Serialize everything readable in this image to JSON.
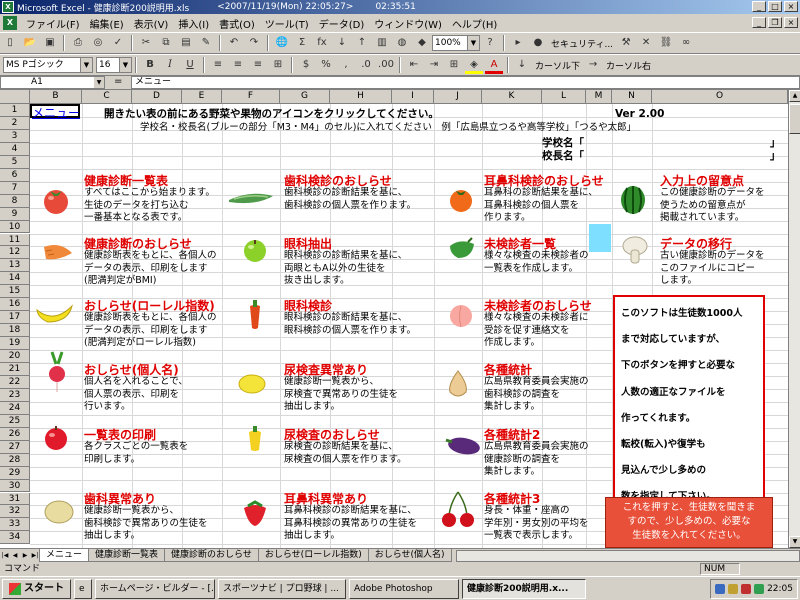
{
  "window": {
    "title": "Microsoft Excel - 健康診断200説明用.xls",
    "title_date": "<2007/11/19(Mon) 22:05:27>",
    "title_time": "02:35:51"
  },
  "menu": [
    "ファイル(F)",
    "編集(E)",
    "表示(V)",
    "挿入(I)",
    "書式(O)",
    "ツール(T)",
    "データ(D)",
    "ウィンドウ(W)",
    "ヘルプ(H)"
  ],
  "toolbar": {
    "zoom": "100%",
    "security_label": "セキュリティ...",
    "font_name": "MS Pゴシック",
    "font_size": "16",
    "cursor_down": "カーソル下",
    "cursor_right": "カーソル右"
  },
  "formula_bar": {
    "name_box": "A1",
    "content": "メニュー"
  },
  "columns": [
    "B",
    "C",
    "D",
    "E",
    "F",
    "G",
    "H",
    "I",
    "J",
    "K",
    "L",
    "M",
    "N",
    "O"
  ],
  "rows": [
    "1",
    "2",
    "3",
    "4",
    "5",
    "6",
    "7",
    "8",
    "9",
    "10",
    "11",
    "12",
    "13",
    "14",
    "15",
    "16",
    "17",
    "18",
    "19",
    "20",
    "21",
    "22",
    "23",
    "24",
    "25",
    "26",
    "27",
    "28",
    "29",
    "30",
    "31",
    "32",
    "33",
    "34"
  ],
  "sheet": {
    "menu_link": "メニュー",
    "instruction": "開きたい表の前にある野菜や果物のアイコンをクリックしてください。",
    "version": "Ver 2.00",
    "school_note": "学校名・校長名(ブルーの部分「M3・M4」のセル)に入れてください　例「広島県立つるや高等学校」「つるや太郎」",
    "school_name_label": "学校名「",
    "principal_label": "校長名「",
    "close_bracket": "」"
  },
  "items": [
    {
      "title": "健康診断一覧表",
      "lines": [
        "すべてはここから始まります。",
        "生徒のデータを打ち込む",
        "一番基本となる表です。"
      ]
    },
    {
      "title": "歯科検診のおしらせ",
      "lines": [
        "歯科検診の診断結果を基に、",
        "歯科検診の個人票を作ります。"
      ]
    },
    {
      "title": "耳鼻科検診のおしらせ",
      "lines": [
        "耳鼻科の診断結果を基に、",
        "耳鼻科検診の個人票を",
        "作ります。"
      ]
    },
    {
      "title": "入力上の留意点",
      "lines": [
        "この健康診断のデータを",
        "使うための留意点が",
        "掲載されています。"
      ]
    },
    {
      "title": "健康診断のおしらせ",
      "lines": [
        "健康診断表をもとに、各個人の",
        "データの表示、印刷をします",
        "(肥満判定がBMI)"
      ]
    },
    {
      "title": "眼科抽出",
      "lines": [
        "眼科検診の診断結果を基に、",
        "両眼ともA以外の生徒を",
        "抜き出します。"
      ]
    },
    {
      "title": "未検診者一覧",
      "lines": [
        "様々な検査の未検診者の",
        "一覧表を作成します。"
      ]
    },
    {
      "title": "データの移行",
      "lines": [
        "古い健康診断のデータを",
        "このファイルにコピー",
        "します。"
      ]
    },
    {
      "title": "おしらせ(ローレル指数)",
      "lines": [
        "健康診断表をもとに、各個人の",
        "データの表示、印刷をします",
        "(肥満判定がローレル指数)"
      ]
    },
    {
      "title": "眼科検診",
      "lines": [
        "眼科検診の診断結果を基に、",
        "眼科検診の個人票を作ります。"
      ]
    },
    {
      "title": "未検診者のおしらせ",
      "lines": [
        "様々な検査の未検診者に",
        "受診を促す連絡文を",
        "作成します。"
      ]
    },
    {
      "title": "おしらせ(個人名)",
      "lines": [
        "個人名を入れることで、",
        "個人票の表示、印刷を",
        "行います。"
      ]
    },
    {
      "title": "尿検査異常あり",
      "lines": [
        "健康診断一覧表から、",
        "尿検査で異常ありの生徒を",
        "抽出します。"
      ]
    },
    {
      "title": "各種統計",
      "lines": [
        "広島県教育委員会実施の",
        "歯科検診の調査を",
        "集計します。"
      ]
    },
    {
      "title": "一覧表の印刷",
      "lines": [
        "各クラスごとの一覧表を",
        "印刷します。"
      ]
    },
    {
      "title": "尿検査のおしらせ",
      "lines": [
        "尿検査の診断結果を基に、",
        "尿検査の個人票を作ります。"
      ]
    },
    {
      "title": "各種統計2",
      "lines": [
        "広島県教育委員会実施の",
        "健康診断の調査を",
        "集計します。"
      ]
    },
    {
      "title": "歯科異常あり",
      "lines": [
        "健康診断一覧表から、",
        "歯科検診で異常ありの生徒を",
        "抽出します。"
      ]
    },
    {
      "title": "耳鼻科異常あり",
      "lines": [
        "耳鼻科検診の診断結果を基に、",
        "耳鼻科検診の異常ありの生徒を",
        "抽出します。"
      ]
    },
    {
      "title": "各種統計3",
      "lines": [
        "身長・体重・座高の",
        "学年別・男女別の平均を",
        "一覧表で表示します。"
      ]
    }
  ],
  "note_box": [
    "このソフトは生徒数1000人",
    "まで対応していますが、",
    "下のボタンを押すと必要な",
    "人数の適正なファイルを",
    "作ってくれます。",
    "転校(転入)や復学も",
    "見込んで少し多めの",
    "数を指定して下さい。"
  ],
  "red_button": [
    "これを押すと、生徒数を聞きま",
    "すので、少し多めの、必要な",
    "生徒数を入れてください。"
  ],
  "sheet_tabs": [
    "メニュー",
    "健康診断一覧表",
    "健康診断のおしらせ",
    "おしらせ(ローレル指数)",
    "おしらせ(個人名)"
  ],
  "status": {
    "left": "コマンド",
    "num": "NUM"
  },
  "taskbar": {
    "start": "スタート",
    "buttons": [
      "ホームページ・ビルダー - [...",
      "スポーツナビ | プロ野球 | ...",
      "Adobe Photoshop",
      "健康診断200説明用.x..."
    ],
    "clock": "22:05"
  },
  "colors": {
    "title_red": "#e00000",
    "accent_cyan": "#7fdfff",
    "button_red": "#e8503a"
  }
}
